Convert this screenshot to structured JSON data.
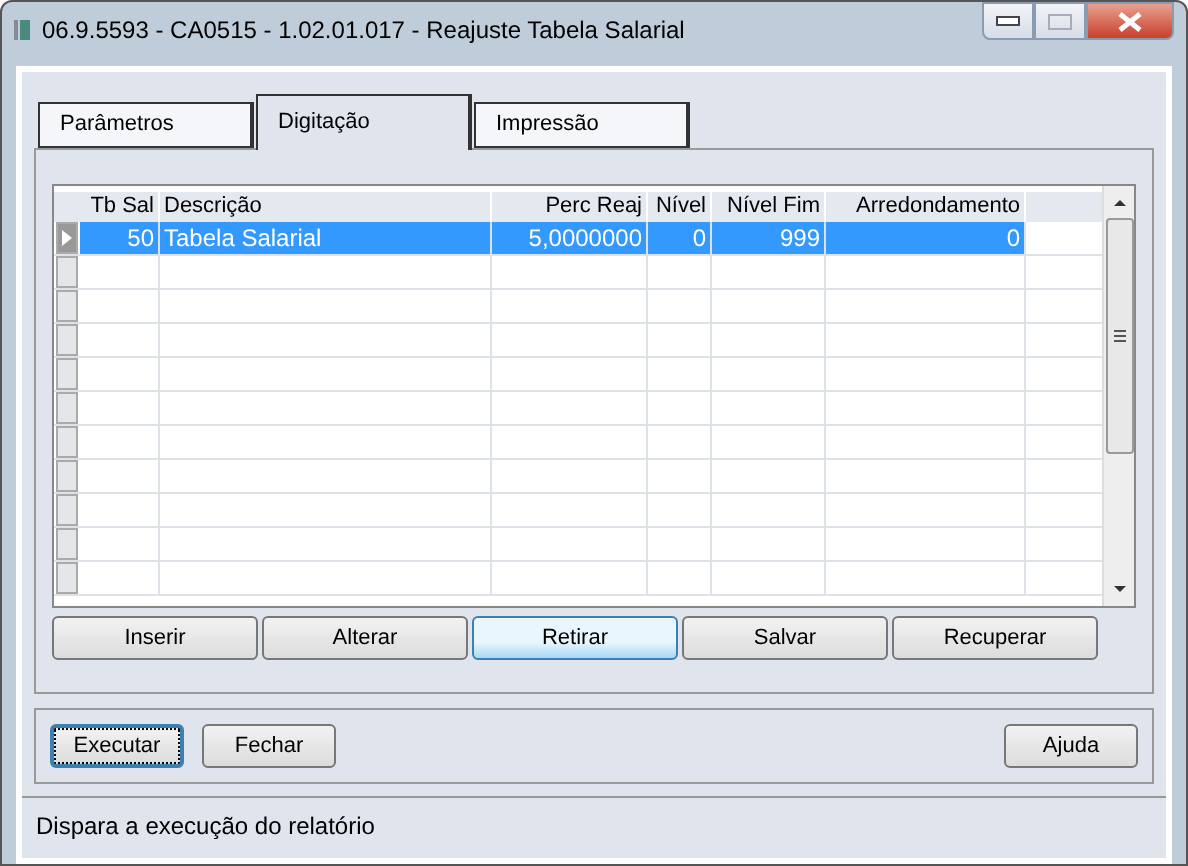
{
  "window": {
    "title": "06.9.5593 - CA0515 - 1.02.01.017 - Reajuste Tabela Salarial"
  },
  "tabs": [
    {
      "label": "Parâmetros",
      "selected": false
    },
    {
      "label": "Digitação",
      "selected": true
    },
    {
      "label": "Impressão",
      "selected": false
    }
  ],
  "table": {
    "columns": [
      "Tb Sal",
      "Descrição",
      "Perc Reaj",
      "Nível",
      "Nível Fim",
      "Arredondamento"
    ],
    "rows": [
      {
        "cells": [
          "50",
          "Tabela Salarial",
          "5,0000000",
          "0",
          "999",
          "0"
        ],
        "selected": true
      }
    ]
  },
  "grid_buttons": [
    {
      "label": "Inserir",
      "hovered": false
    },
    {
      "label": "Alterar",
      "hovered": false
    },
    {
      "label": "Retirar",
      "hovered": true
    },
    {
      "label": "Salvar",
      "hovered": false
    },
    {
      "label": "Recuperar",
      "hovered": false
    }
  ],
  "footer_buttons": [
    {
      "label": "Executar",
      "focused": true
    },
    {
      "label": "Fechar",
      "focused": false
    }
  ],
  "help_button": {
    "label": "Ajuda",
    "focused": false
  },
  "status_bar": "Dispara a execução do relatório"
}
